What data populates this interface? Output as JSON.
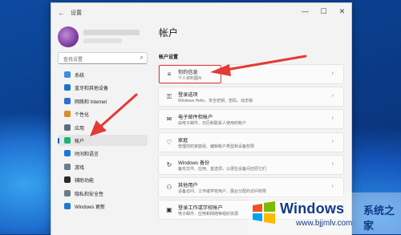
{
  "window": {
    "app_title": "设置",
    "back_icon": "←",
    "controls": [
      "—",
      "☐",
      "✕"
    ]
  },
  "search": {
    "placeholder": "查找设置"
  },
  "sidebar": {
    "items": [
      {
        "label": "系统",
        "icon": "monitor-icon",
        "color": "#3a8ee6",
        "active": false
      },
      {
        "label": "蓝牙和其他设备",
        "icon": "bluetooth-icon",
        "color": "#1a73c9",
        "active": false
      },
      {
        "label": "网络和 Internet",
        "icon": "wifi-icon",
        "color": "#2a6fd1",
        "active": false
      },
      {
        "label": "个性化",
        "icon": "brush-icon",
        "color": "#e08a2c",
        "active": false
      },
      {
        "label": "应用",
        "icon": "apps-icon",
        "color": "#5a6d86",
        "active": false
      },
      {
        "label": "帐户",
        "icon": "person-icon",
        "color": "#1bb27a",
        "active": true
      },
      {
        "label": "时间和语言",
        "icon": "globe-clock-icon",
        "color": "#1a79d6",
        "active": false
      },
      {
        "label": "游戏",
        "icon": "gamepad-icon",
        "color": "#6b7a8c",
        "active": false
      },
      {
        "label": "辅助功能",
        "icon": "accessibility-icon",
        "color": "#2a2a2a",
        "active": false
      },
      {
        "label": "隐私和安全性",
        "icon": "shield-icon",
        "color": "#6b7a8c",
        "active": false
      },
      {
        "label": "Windows 更新",
        "icon": "update-icon",
        "color": "#1a79d6",
        "active": false
      }
    ]
  },
  "main": {
    "title": "帐户",
    "section_label": "帐户设置",
    "cards": [
      {
        "title": "你的信息",
        "subtitle": "个人资料图片",
        "icon": "person-card-icon",
        "glyph": "≡",
        "highlighted": true
      },
      {
        "title": "登录选项",
        "subtitle": "Windows Hello、安全密钥、密码、动态锁",
        "icon": "key-icon",
        "glyph": "⚿",
        "highlighted": false
      },
      {
        "title": "电子邮件和帐户",
        "subtitle": "由电子邮件、日历和联系人使用的帐户",
        "icon": "mail-icon",
        "glyph": "✉",
        "highlighted": false
      },
      {
        "title": "家庭",
        "subtitle": "管理你的家庭组、编辑帐户类型和设备权限",
        "icon": "family-heart-icon",
        "glyph": "♡",
        "highlighted": false
      },
      {
        "title": "Windows 备份",
        "subtitle": "备份文件、应用、首选项，以便在设备间还原它们",
        "icon": "backup-icon",
        "glyph": "↻",
        "highlighted": false
      },
      {
        "title": "其他用户",
        "subtitle": "设备访问、工作或学校用户、展台分配的访问权限",
        "icon": "other-users-icon",
        "glyph": "⚇",
        "highlighted": false
      },
      {
        "title": "登录工作或学校帐户",
        "subtitle": "电子邮件、应用和网络等组织资源",
        "icon": "briefcase-icon",
        "glyph": "▣",
        "highlighted": false
      }
    ]
  },
  "watermark": {
    "brand": "Windows",
    "site_name": "系统之家",
    "url": "www.bjjmlv.com"
  },
  "colors": {
    "accent": "#005fb8",
    "annotation_red": "#e53935"
  }
}
